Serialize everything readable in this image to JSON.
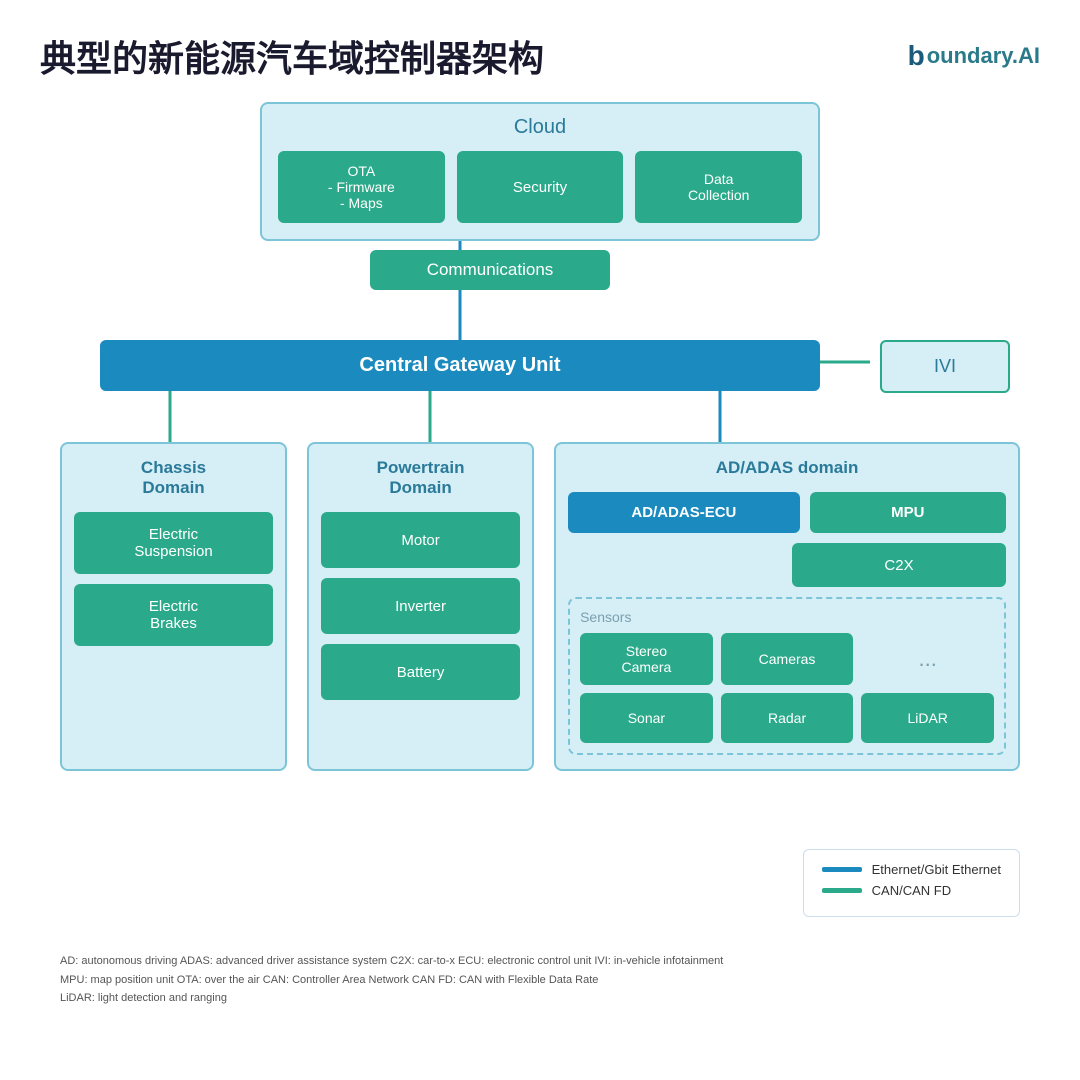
{
  "header": {
    "title": "典型的新能源汽车域控制器架构",
    "logo_text": "oundary.AI",
    "logo_b": "b"
  },
  "cloud": {
    "title": "Cloud",
    "items": [
      {
        "id": "ota",
        "label": "OTA\n- Firmware\n- Maps"
      },
      {
        "id": "security",
        "label": "Security"
      },
      {
        "id": "data-collection",
        "label": "Data\nCollection"
      }
    ]
  },
  "communications": {
    "label": "Communications"
  },
  "cgu": {
    "label": "Central Gateway Unit"
  },
  "ivi": {
    "label": "IVI"
  },
  "chassis": {
    "title": "Chassis\nDomain",
    "items": [
      {
        "id": "electric-suspension",
        "label": "Electric\nSuspension"
      },
      {
        "id": "electric-brakes",
        "label": "Electric\nBrakes"
      }
    ]
  },
  "powertrain": {
    "title": "Powertrain\nDomain",
    "items": [
      {
        "id": "motor",
        "label": "Motor"
      },
      {
        "id": "inverter",
        "label": "Inverter"
      },
      {
        "id": "battery",
        "label": "Battery"
      }
    ]
  },
  "adas": {
    "title": "AD/ADAS domain",
    "ecu_label": "AD/ADAS-ECU",
    "mpu_label": "MPU",
    "c2x_label": "C2X",
    "sensors_label": "Sensors",
    "sensors": [
      {
        "id": "stereo-camera",
        "label": "Stereo\nCamera"
      },
      {
        "id": "cameras",
        "label": "Cameras"
      },
      {
        "id": "sonar",
        "label": "Sonar"
      },
      {
        "id": "radar",
        "label": "Radar"
      },
      {
        "id": "lidar",
        "label": "LiDAR"
      }
    ],
    "dots": "..."
  },
  "legend": {
    "items": [
      {
        "id": "ethernet",
        "label": "Ethernet/Gbit Ethernet",
        "color_class": "legend-line-blue"
      },
      {
        "id": "can",
        "label": "CAN/CAN FD",
        "color_class": "legend-line-teal"
      }
    ]
  },
  "footer": {
    "lines": [
      "AD: autonomous driving    ADAS: advanced driver assistance system    C2X: car-to-x    ECU: electronic control unit  IVI: in-vehicle infotainment",
      "MPU: map position unit   OTA: over the air    CAN: Controller Area Network    CAN FD: CAN with Flexible Data Rate",
      "LiDAR: light detection and ranging"
    ]
  },
  "colors": {
    "blue": "#1a8abf",
    "teal": "#2aaa8a",
    "light_blue_bg": "#d6eef5",
    "border": "#7cc5d8"
  }
}
